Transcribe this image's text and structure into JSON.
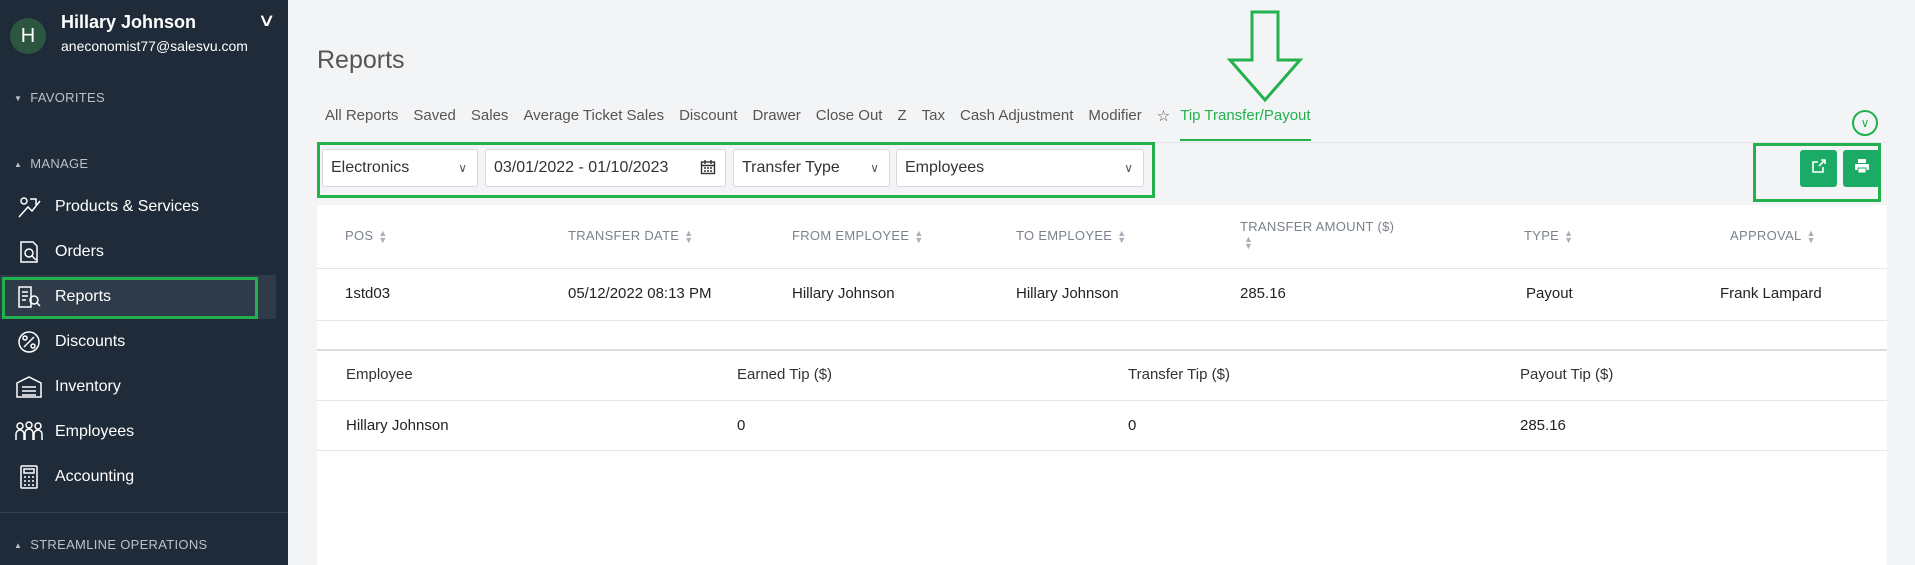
{
  "sidebar": {
    "user": {
      "initial": "H",
      "name": "Hillary Johnson",
      "email": "aneconomist77@salesvu.com"
    },
    "sections": {
      "favorites": "FAVORITES",
      "manage": "MANAGE",
      "streamline": "STREAMLINE OPERATIONS"
    },
    "items": [
      {
        "label": "Products & Services",
        "icon": "products-icon"
      },
      {
        "label": "Orders",
        "icon": "orders-icon"
      },
      {
        "label": "Reports",
        "icon": "reports-icon",
        "active": true
      },
      {
        "label": "Discounts",
        "icon": "discounts-icon"
      },
      {
        "label": "Inventory",
        "icon": "inventory-icon"
      },
      {
        "label": "Employees",
        "icon": "employees-icon"
      },
      {
        "label": "Accounting",
        "icon": "accounting-icon"
      }
    ]
  },
  "page": {
    "title": "Reports"
  },
  "tabs": [
    "All Reports",
    "Saved",
    "Sales",
    "Average Ticket Sales",
    "Discount",
    "Drawer",
    "Close Out",
    "Z",
    "Tax",
    "Cash Adjustment",
    "Modifier",
    "Tip Transfer/Payout"
  ],
  "filters": {
    "category": "Electronics",
    "date_range": "03/01/2022 - 01/10/2023",
    "transfer_type": "Transfer Type",
    "employees": "Employees"
  },
  "transfers": {
    "columns": [
      "POS",
      "TRANSFER DATE",
      "FROM EMPLOYEE",
      "TO EMPLOYEE",
      "TRANSFER AMOUNT ($)",
      "TYPE",
      "APPROVAL"
    ],
    "rows": [
      [
        "1std03",
        "05/12/2022 08:13 PM",
        "Hillary Johnson",
        "Hillary Johnson",
        "285.16",
        "Payout",
        "Frank Lampard"
      ]
    ]
  },
  "summary": {
    "columns": [
      "Employee",
      "Earned Tip ($)",
      "Transfer Tip ($)",
      "Payout Tip ($)"
    ],
    "rows": [
      [
        "Hillary Johnson",
        "0",
        "0",
        "285.16"
      ]
    ]
  },
  "colors": {
    "accent": "#22b14c",
    "sidebar": "#1f2b38",
    "button": "#1cab66"
  }
}
